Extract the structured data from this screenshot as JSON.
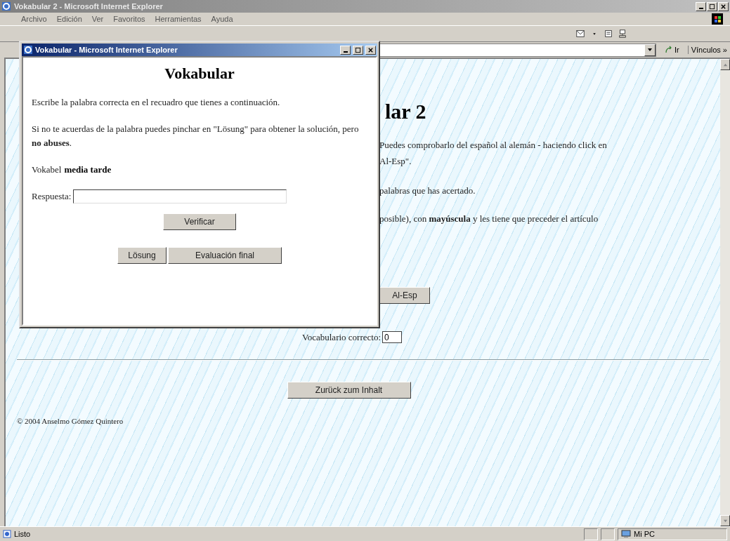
{
  "window": {
    "title": "Vokabular 2 - Microsoft Internet Explorer"
  },
  "menu": [
    "Archivo",
    "Edición",
    "Ver",
    "Favoritos",
    "Herramientas",
    "Ayuda"
  ],
  "address_bar": {
    "go_label": "Ir",
    "links_label": "Vínculos »"
  },
  "page": {
    "heading": "lar 2",
    "paragraphs": [
      "Puedes comprobarlo del español al alemán - haciendo click en",
      "Al-Esp\".",
      "palabras que has acertado.",
      "posible), con **mayúscula** y les tiene que preceder el artículo"
    ],
    "direction_button": "Al-Esp",
    "score_label": "Vocabulario correcto:",
    "score_value": "0",
    "back_button": "Zurück zum Inhalt",
    "copyright": "© 2004 Anselmo Gómez Quintero"
  },
  "popup": {
    "title": "Vokabular - Microsoft Internet Explorer",
    "heading": "Vokabular",
    "instructions": [
      "Escribe la palabra correcta en el recuadro que tienes a continuación.",
      "Si no te acuerdas de la palabra puedes pinchar en \"Lösung\" para obtener la solución, pero **no abuses**."
    ],
    "word_label": "Vokabel",
    "word": "media tarde",
    "answer_label": "Respuesta:",
    "check_button": "Verificar",
    "buttons": [
      "Lösung",
      "Evaluación final"
    ]
  },
  "status_bar": {
    "text": "Listo",
    "zone": "Mi PC"
  }
}
